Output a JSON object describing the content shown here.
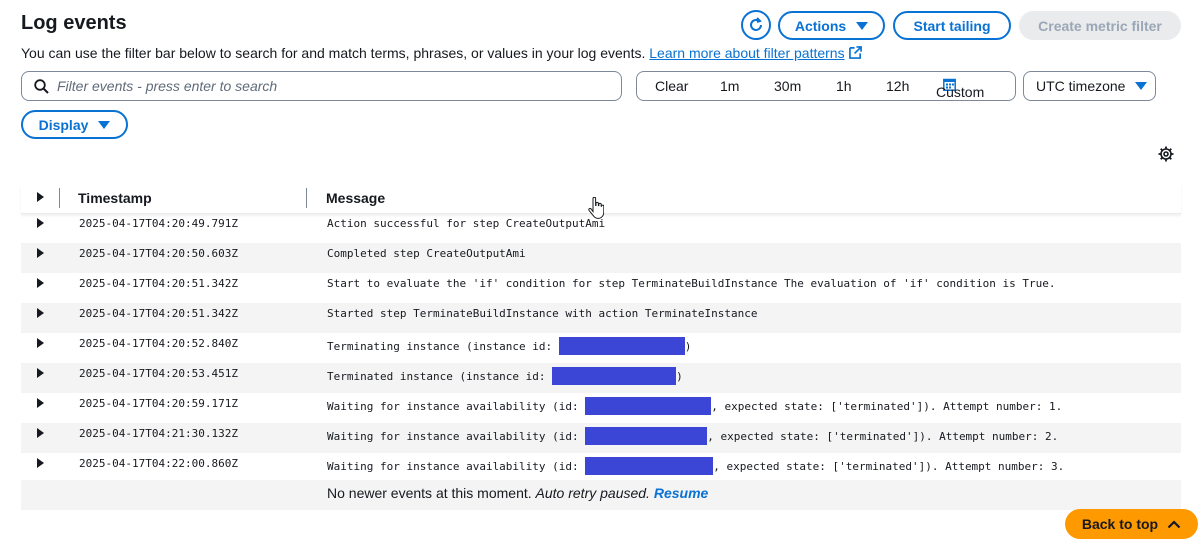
{
  "header": {
    "title": "Log events",
    "description": "You can use the filter bar below to search for and match terms, phrases, or values in your log events.",
    "learn_more": "Learn more about filter patterns"
  },
  "toolbar": {
    "actions_label": "Actions",
    "start_tailing_label": "Start tailing",
    "create_metric_filter_label": "Create metric filter"
  },
  "search": {
    "placeholder": "Filter events - press enter to search",
    "value": ""
  },
  "time_range": {
    "clear": "Clear",
    "options": [
      "1m",
      "30m",
      "1h",
      "12h"
    ],
    "custom": "Custom"
  },
  "timezone": "UTC timezone",
  "display_label": "Display",
  "table": {
    "columns": [
      "Timestamp",
      "Message"
    ],
    "rows": [
      {
        "timestamp": "2025-04-17T04:20:49.791Z",
        "message": "Action successful for step CreateOutputAmi"
      },
      {
        "timestamp": "2025-04-17T04:20:50.603Z",
        "message": "Completed step CreateOutputAmi"
      },
      {
        "timestamp": "2025-04-17T04:20:51.342Z",
        "message": "Start to evaluate the 'if' condition for step TerminateBuildInstance The evaluation of 'if' condition is True."
      },
      {
        "timestamp": "2025-04-17T04:20:51.342Z",
        "message": "Started step TerminateBuildInstance with action TerminateInstance"
      },
      {
        "timestamp": "2025-04-17T04:20:52.840Z",
        "message_pre": "Terminating instance (instance id: ",
        "message_post": ")"
      },
      {
        "timestamp": "2025-04-17T04:20:53.451Z",
        "message_pre": "Terminated instance (instance id: ",
        "message_post": ")"
      },
      {
        "timestamp": "2025-04-17T04:20:59.171Z",
        "message_pre": "Waiting for instance availability (id: ",
        "message_post": ", expected state: ['terminated']). Attempt number: 1."
      },
      {
        "timestamp": "2025-04-17T04:21:30.132Z",
        "message_pre": "Waiting for instance availability (id: ",
        "message_post": ", expected state: ['terminated']). Attempt number: 2."
      },
      {
        "timestamp": "2025-04-17T04:22:00.860Z",
        "message_pre": "Waiting for instance availability (id: ",
        "message_post": ", expected state: ['terminated']). Attempt number: 3."
      }
    ]
  },
  "footer": {
    "status": "No newer events at this moment.",
    "auto_retry": "Auto retry paused.",
    "resume": "Resume"
  },
  "back_to_top": "Back to top",
  "colors": {
    "accent": "#0972d3",
    "redaction": "#3b45d6",
    "back_to_top": "#ff9900"
  }
}
